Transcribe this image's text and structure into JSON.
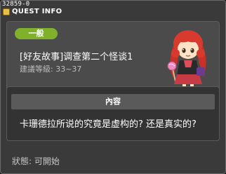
{
  "window": {
    "quest_id": "32859-0",
    "title": "QUEST INFO"
  },
  "quest": {
    "category": "一般",
    "name": "[好友故事]调查第二个怪谈1",
    "level_label": "建議等級:",
    "level_range": "33~37"
  },
  "content": {
    "header": "內容",
    "text": "卡珊德拉所说的究竟是虚构的? 还是真实的?"
  },
  "status": {
    "label": "狀態:",
    "value": "可開始"
  },
  "colors": {
    "background": "#3a3a3a",
    "panel": "#4b4b4b",
    "badge_green": "#7fb22a",
    "content_header": "#5a5a5a"
  },
  "icons": {
    "title": "quest-info-icon",
    "npc": "npc-portrait-red-hair-girl"
  }
}
